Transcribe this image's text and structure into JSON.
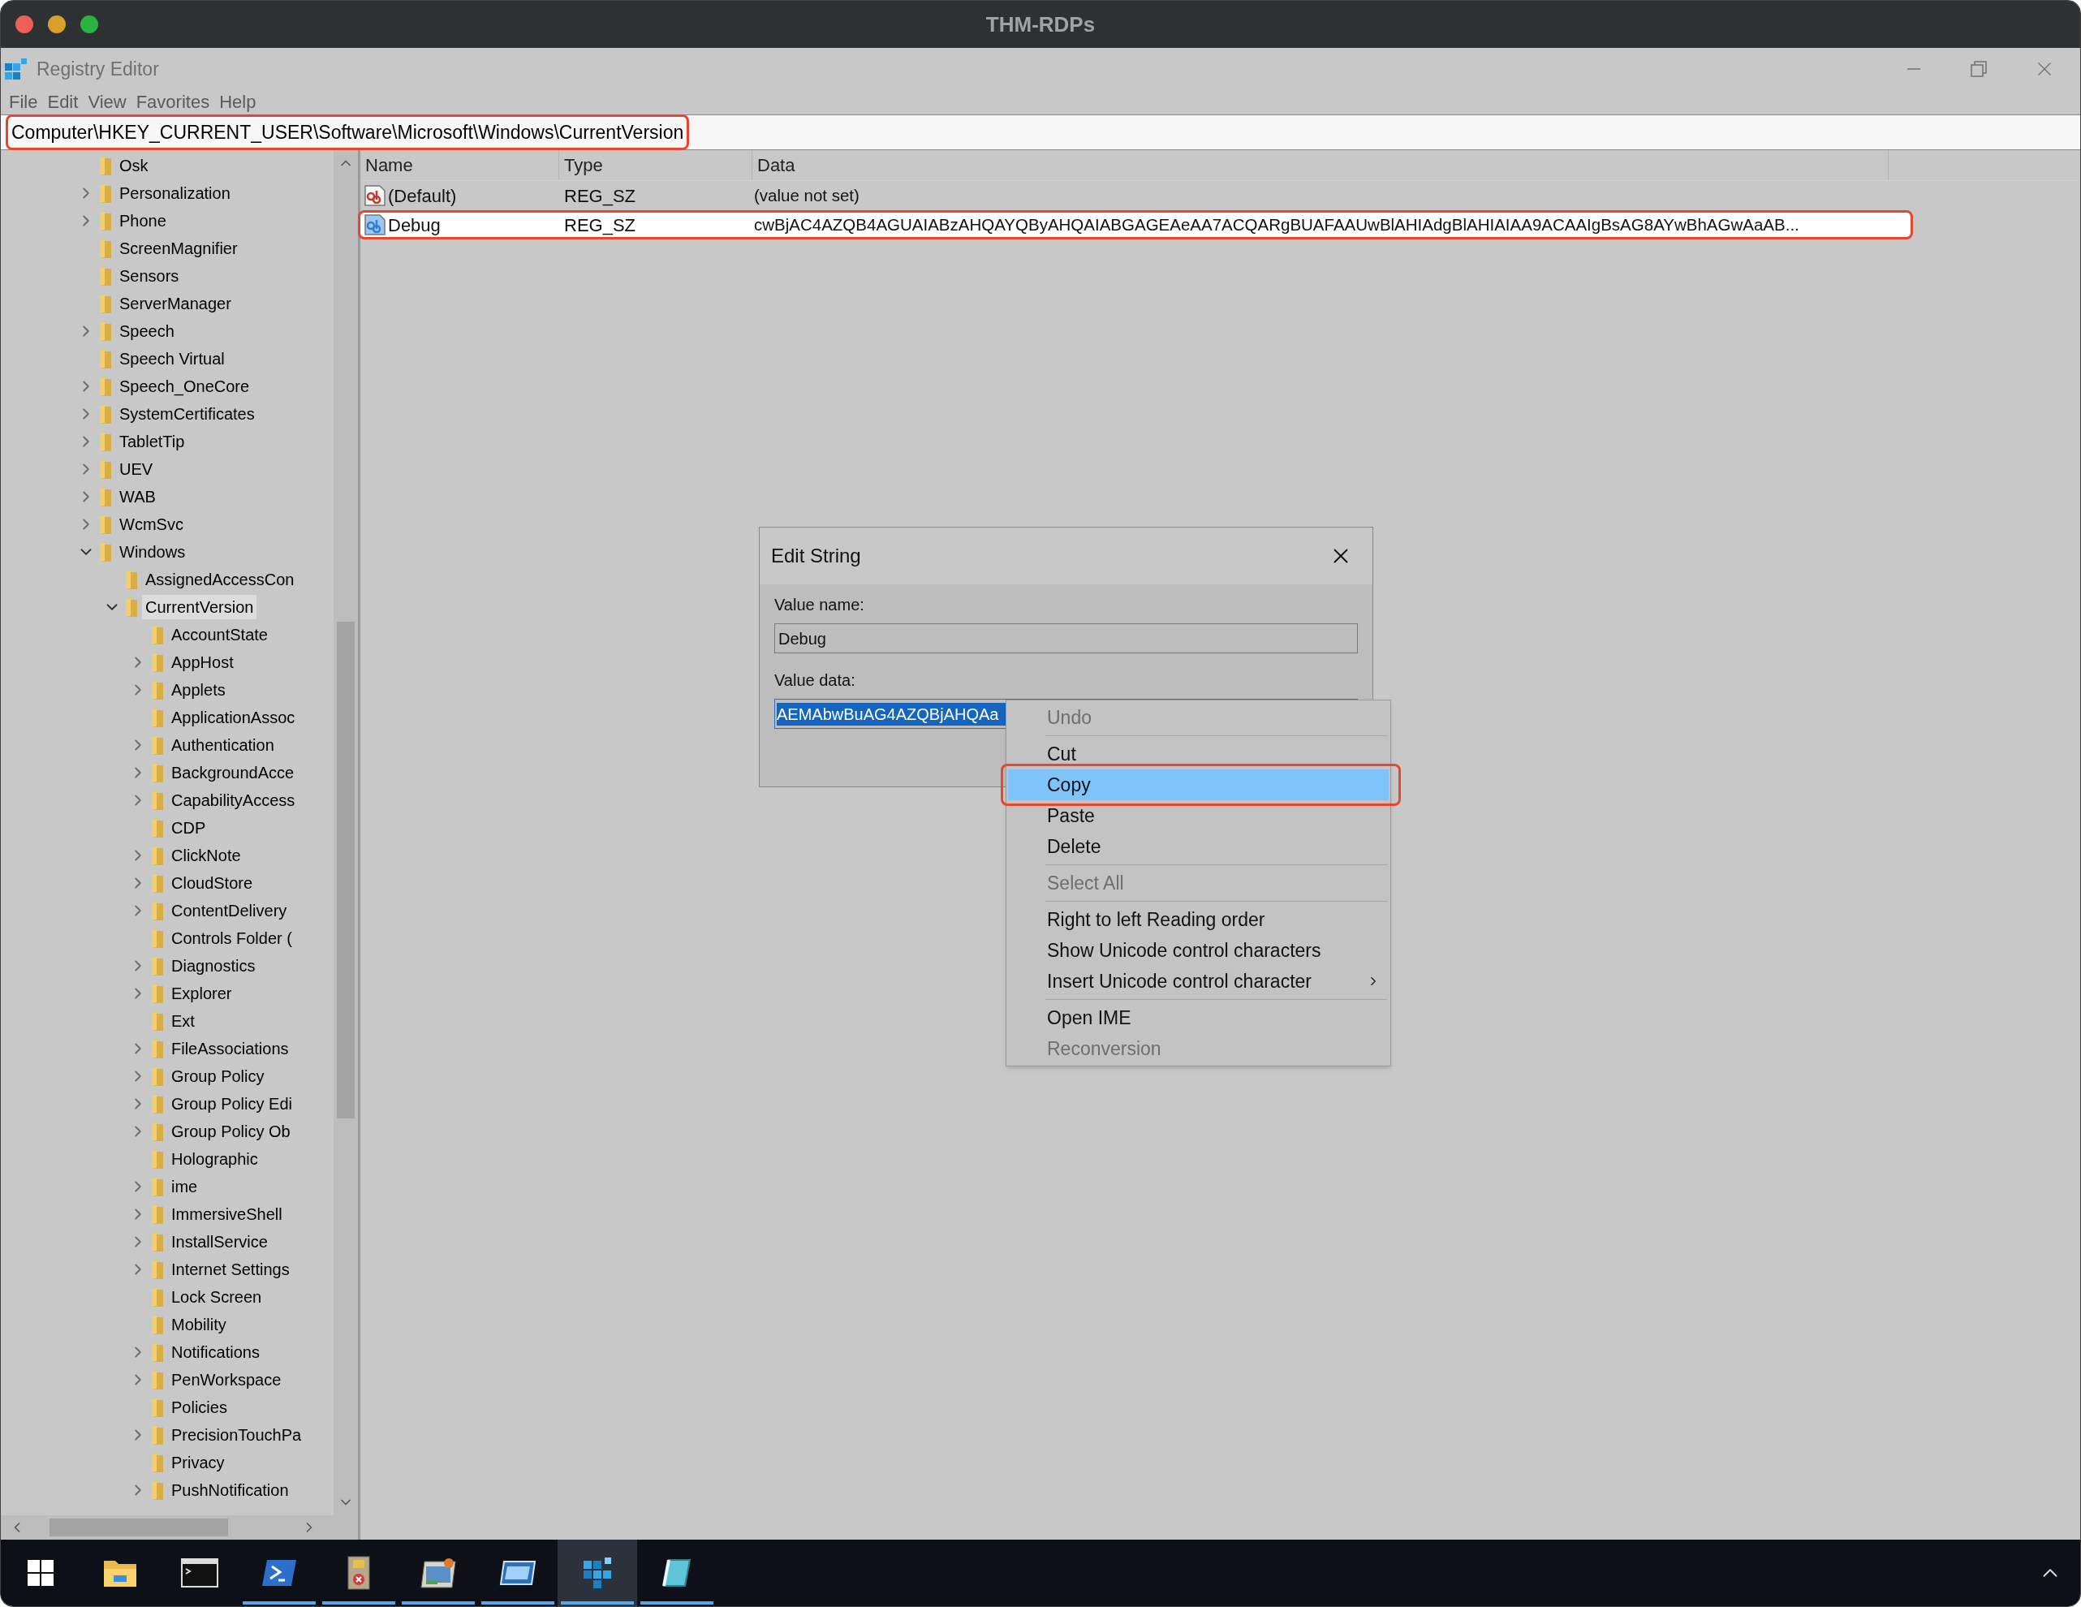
{
  "host_window": {
    "title": "THM-RDPs"
  },
  "app": {
    "title": "Registry Editor"
  },
  "menu": [
    "File",
    "Edit",
    "View",
    "Favorites",
    "Help"
  ],
  "address": {
    "path": "Computer\\HKEY_CURRENT_USER\\Software\\Microsoft\\Windows\\CurrentVersion",
    "outlined": true
  },
  "tree": [
    {
      "label": "Osk",
      "kind": "leaf",
      "selected": false
    },
    {
      "label": "Personalization",
      "kind": "collapsed",
      "selected": false
    },
    {
      "label": "Phone",
      "kind": "collapsed",
      "selected": false
    },
    {
      "label": "ScreenMagnifier",
      "kind": "leaf",
      "selected": false
    },
    {
      "label": "Sensors",
      "kind": "leaf",
      "selected": false
    },
    {
      "label": "ServerManager",
      "kind": "leaf",
      "selected": false
    },
    {
      "label": "Speech",
      "kind": "collapsed",
      "selected": false
    },
    {
      "label": "Speech Virtual",
      "kind": "leaf",
      "selected": false
    },
    {
      "label": "Speech_OneCore",
      "kind": "collapsed",
      "selected": false
    },
    {
      "label": "SystemCertificates",
      "kind": "collapsed",
      "selected": false
    },
    {
      "label": "TabletTip",
      "kind": "collapsed",
      "selected": false
    },
    {
      "label": "UEV",
      "kind": "collapsed",
      "selected": false
    },
    {
      "label": "WAB",
      "kind": "collapsed",
      "selected": false
    },
    {
      "label": "WcmSvc",
      "kind": "collapsed",
      "selected": false
    },
    {
      "label": "Windows",
      "kind": "expanded",
      "selected": false,
      "children": [
        {
          "label": "AssignedAccessCon",
          "kind": "leaf",
          "selected": false
        },
        {
          "label": "CurrentVersion",
          "kind": "expanded",
          "selected": true,
          "children": [
            {
              "label": "AccountState",
              "kind": "leaf",
              "selected": false
            },
            {
              "label": "AppHost",
              "kind": "collapsed",
              "selected": false
            },
            {
              "label": "Applets",
              "kind": "collapsed",
              "selected": false
            },
            {
              "label": "ApplicationAssoc",
              "kind": "leaf",
              "selected": false
            },
            {
              "label": "Authentication",
              "kind": "collapsed",
              "selected": false
            },
            {
              "label": "BackgroundAcce",
              "kind": "collapsed",
              "selected": false
            },
            {
              "label": "CapabilityAccess",
              "kind": "collapsed",
              "selected": false
            },
            {
              "label": "CDP",
              "kind": "leaf",
              "selected": false
            },
            {
              "label": "ClickNote",
              "kind": "collapsed",
              "selected": false
            },
            {
              "label": "CloudStore",
              "kind": "collapsed",
              "selected": false
            },
            {
              "label": "ContentDelivery",
              "kind": "collapsed",
              "selected": false
            },
            {
              "label": "Controls Folder (",
              "kind": "leaf",
              "selected": false
            },
            {
              "label": "Diagnostics",
              "kind": "collapsed",
              "selected": false
            },
            {
              "label": "Explorer",
              "kind": "collapsed",
              "selected": false
            },
            {
              "label": "Ext",
              "kind": "leaf",
              "selected": false
            },
            {
              "label": "FileAssociations",
              "kind": "collapsed",
              "selected": false
            },
            {
              "label": "Group Policy",
              "kind": "collapsed",
              "selected": false
            },
            {
              "label": "Group Policy Edi",
              "kind": "collapsed",
              "selected": false
            },
            {
              "label": "Group Policy Ob",
              "kind": "collapsed",
              "selected": false
            },
            {
              "label": "Holographic",
              "kind": "leaf",
              "selected": false
            },
            {
              "label": "ime",
              "kind": "collapsed",
              "selected": false
            },
            {
              "label": "ImmersiveShell",
              "kind": "collapsed",
              "selected": false
            },
            {
              "label": "InstallService",
              "kind": "collapsed",
              "selected": false
            },
            {
              "label": "Internet Settings",
              "kind": "collapsed",
              "selected": false
            },
            {
              "label": "Lock Screen",
              "kind": "leaf",
              "selected": false
            },
            {
              "label": "Mobility",
              "kind": "leaf",
              "selected": false
            },
            {
              "label": "Notifications",
              "kind": "collapsed",
              "selected": false
            },
            {
              "label": "PenWorkspace",
              "kind": "collapsed",
              "selected": false
            },
            {
              "label": "Policies",
              "kind": "leaf",
              "selected": false
            },
            {
              "label": "PrecisionTouchPa",
              "kind": "collapsed",
              "selected": false
            },
            {
              "label": "Privacy",
              "kind": "leaf",
              "selected": false
            },
            {
              "label": "PushNotification",
              "kind": "collapsed",
              "selected": false
            }
          ]
        }
      ]
    }
  ],
  "values": {
    "columns": [
      "Name",
      "Type",
      "Data"
    ],
    "rows": [
      {
        "name": "(Default)",
        "type": "REG_SZ",
        "data": "(value not set)",
        "selected": false,
        "outlined": false
      },
      {
        "name": "Debug",
        "type": "REG_SZ",
        "data": "cwBjAC4AZQB4AGUAIABzAHQAYQByAHQAIABGAGEAeAA7ACQARgBUAFAAUwBlAHIAdgBlAHIAIAA9ACAAIgBsAG8AYwBhAGwAaAB...",
        "selected": true,
        "outlined": true
      }
    ]
  },
  "dialog": {
    "title": "Edit String",
    "value_name_label": "Value name:",
    "value_name": "Debug",
    "value_data_label": "Value data:",
    "value_data": "AEMAbwBuAG4AZQBjAHQAa"
  },
  "context_menu": [
    {
      "kind": "item",
      "label": "Undo",
      "disabled": true,
      "selected": false,
      "submenu": false,
      "outlined": false
    },
    {
      "kind": "separator"
    },
    {
      "kind": "item",
      "label": "Cut",
      "disabled": false,
      "selected": false,
      "submenu": false,
      "outlined": false
    },
    {
      "kind": "item",
      "label": "Copy",
      "disabled": false,
      "selected": true,
      "submenu": false,
      "outlined": true
    },
    {
      "kind": "item",
      "label": "Paste",
      "disabled": false,
      "selected": false,
      "submenu": false,
      "outlined": false
    },
    {
      "kind": "item",
      "label": "Delete",
      "disabled": false,
      "selected": false,
      "submenu": false,
      "outlined": false
    },
    {
      "kind": "separator"
    },
    {
      "kind": "item",
      "label": "Select All",
      "disabled": true,
      "selected": false,
      "submenu": false,
      "outlined": false
    },
    {
      "kind": "separator"
    },
    {
      "kind": "item",
      "label": "Right to left Reading order",
      "disabled": false,
      "selected": false,
      "submenu": false,
      "outlined": false
    },
    {
      "kind": "item",
      "label": "Show Unicode control characters",
      "disabled": false,
      "selected": false,
      "submenu": false,
      "outlined": false
    },
    {
      "kind": "item",
      "label": "Insert Unicode control character",
      "disabled": false,
      "selected": false,
      "submenu": true,
      "outlined": false
    },
    {
      "kind": "separator"
    },
    {
      "kind": "item",
      "label": "Open IME",
      "disabled": false,
      "selected": false,
      "submenu": false,
      "outlined": false
    },
    {
      "kind": "item",
      "label": "Reconversion",
      "disabled": true,
      "selected": false,
      "submenu": false,
      "outlined": false
    }
  ],
  "taskbar": [
    {
      "kind": "start",
      "running": false,
      "selected": false
    },
    {
      "kind": "folder",
      "running": false,
      "selected": false
    },
    {
      "kind": "terminal",
      "running": false,
      "selected": false
    },
    {
      "kind": "prompt",
      "running": true,
      "selected": false
    },
    {
      "kind": "document",
      "running": true,
      "selected": false
    },
    {
      "kind": "window",
      "running": true,
      "selected": false
    },
    {
      "kind": "monitor",
      "running": true,
      "selected": false
    },
    {
      "kind": "cubes",
      "running": true,
      "selected": true
    },
    {
      "kind": "book",
      "running": true,
      "selected": false
    }
  ]
}
